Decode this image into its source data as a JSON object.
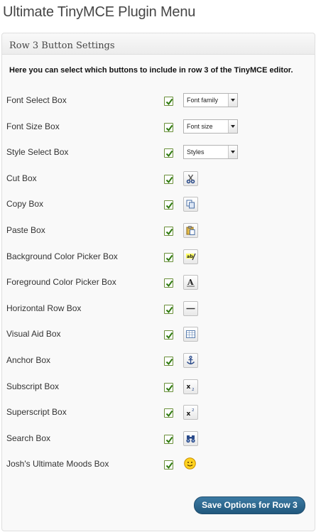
{
  "page": {
    "title": "Ultimate TinyMCE Plugin Menu"
  },
  "panel": {
    "title": "Row 3 Button Settings",
    "description": "Here you can select which buttons to include in row 3 of the TinyMCE editor."
  },
  "rows": [
    {
      "label": "Font Select Box",
      "checked": true,
      "control": "dropdown",
      "control_text": "Font family"
    },
    {
      "label": "Font Size Box",
      "checked": true,
      "control": "dropdown",
      "control_text": "Font size"
    },
    {
      "label": "Style Select Box",
      "checked": true,
      "control": "dropdown",
      "control_text": "Styles"
    },
    {
      "label": "Cut Box",
      "checked": true,
      "control": "icon",
      "icon": "cut-icon"
    },
    {
      "label": "Copy Box",
      "checked": true,
      "control": "icon",
      "icon": "copy-icon"
    },
    {
      "label": "Paste Box",
      "checked": true,
      "control": "icon",
      "icon": "paste-icon"
    },
    {
      "label": "Background Color Picker Box",
      "checked": true,
      "control": "icon",
      "icon": "background-color-icon",
      "icon_text": "ab"
    },
    {
      "label": "Foreground Color Picker Box",
      "checked": true,
      "control": "icon",
      "icon": "foreground-color-icon",
      "icon_text": "A"
    },
    {
      "label": "Horizontal Row Box",
      "checked": true,
      "control": "icon",
      "icon": "horizontal-rule-icon"
    },
    {
      "label": "Visual Aid Box",
      "checked": true,
      "control": "icon",
      "icon": "visual-aid-icon"
    },
    {
      "label": "Anchor Box",
      "checked": true,
      "control": "icon",
      "icon": "anchor-icon"
    },
    {
      "label": "Subscript Box",
      "checked": true,
      "control": "icon",
      "icon": "subscript-icon",
      "icon_text": "x",
      "icon_sub": "2"
    },
    {
      "label": "Superscript Box",
      "checked": true,
      "control": "icon",
      "icon": "superscript-icon",
      "icon_text": "x",
      "icon_sup": "2"
    },
    {
      "label": "Search Box",
      "checked": true,
      "control": "icon",
      "icon": "search-binoculars-icon"
    },
    {
      "label": "Josh's Ultimate Moods Box",
      "checked": true,
      "control": "icon",
      "icon": "smiley-icon"
    }
  ],
  "save_button": {
    "label": "Save Options for Row 3"
  },
  "colors": {
    "accent": "#21587d",
    "check": "#3d7a1d"
  }
}
